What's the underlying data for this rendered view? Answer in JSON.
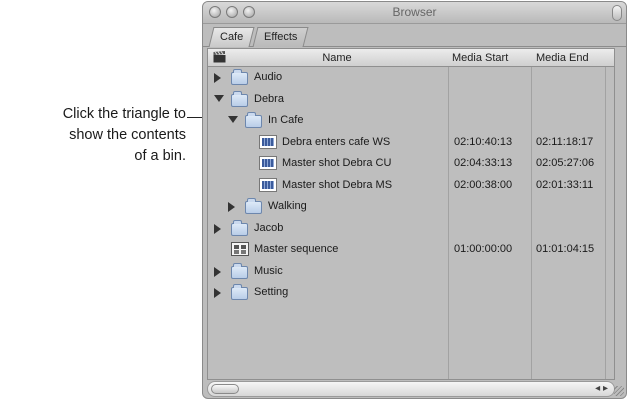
{
  "callout": {
    "lines": [
      "Click the triangle to",
      "show the contents",
      "of a bin."
    ]
  },
  "window": {
    "title": "Browser",
    "tabs": [
      {
        "label": "Cafe",
        "active": true
      },
      {
        "label": "Effects",
        "active": false
      }
    ]
  },
  "table": {
    "headers": {
      "name": "Name",
      "media_start": "Media Start",
      "media_end": "Media End"
    },
    "rows": [
      {
        "icon": "folder-icon",
        "twisty": "collapsed",
        "indent": 0,
        "name": "Audio",
        "media_start": "",
        "media_end": ""
      },
      {
        "icon": "folder-icon",
        "twisty": "expanded",
        "indent": 0,
        "name": "Debra",
        "media_start": "",
        "media_end": ""
      },
      {
        "icon": "folder-icon",
        "twisty": "expanded",
        "indent": 1,
        "name": "In Cafe",
        "media_start": "",
        "media_end": ""
      },
      {
        "icon": "clip-icon",
        "twisty": "none",
        "indent": 2,
        "name": "Debra enters cafe WS",
        "media_start": "02:10:40:13",
        "media_end": "02:11:18:17"
      },
      {
        "icon": "clip-icon",
        "twisty": "none",
        "indent": 2,
        "name": "Master shot Debra CU",
        "media_start": "02:04:33:13",
        "media_end": "02:05:27:06"
      },
      {
        "icon": "clip-icon",
        "twisty": "none",
        "indent": 2,
        "name": "Master shot Debra MS",
        "media_start": "02:00:38:00",
        "media_end": "02:01:33:11"
      },
      {
        "icon": "folder-icon",
        "twisty": "collapsed",
        "indent": 1,
        "name": "Walking",
        "media_start": "",
        "media_end": ""
      },
      {
        "icon": "folder-icon",
        "twisty": "collapsed",
        "indent": 0,
        "name": "Jacob",
        "media_start": "",
        "media_end": ""
      },
      {
        "icon": "sequence-icon",
        "twisty": "none",
        "indent": 0,
        "name": "Master sequence",
        "media_start": "01:00:00:00",
        "media_end": "01:01:04:15"
      },
      {
        "icon": "folder-icon",
        "twisty": "collapsed",
        "indent": 0,
        "name": "Music",
        "media_start": "",
        "media_end": ""
      },
      {
        "icon": "folder-icon",
        "twisty": "collapsed",
        "indent": 0,
        "name": "Setting",
        "media_start": "",
        "media_end": ""
      }
    ]
  }
}
